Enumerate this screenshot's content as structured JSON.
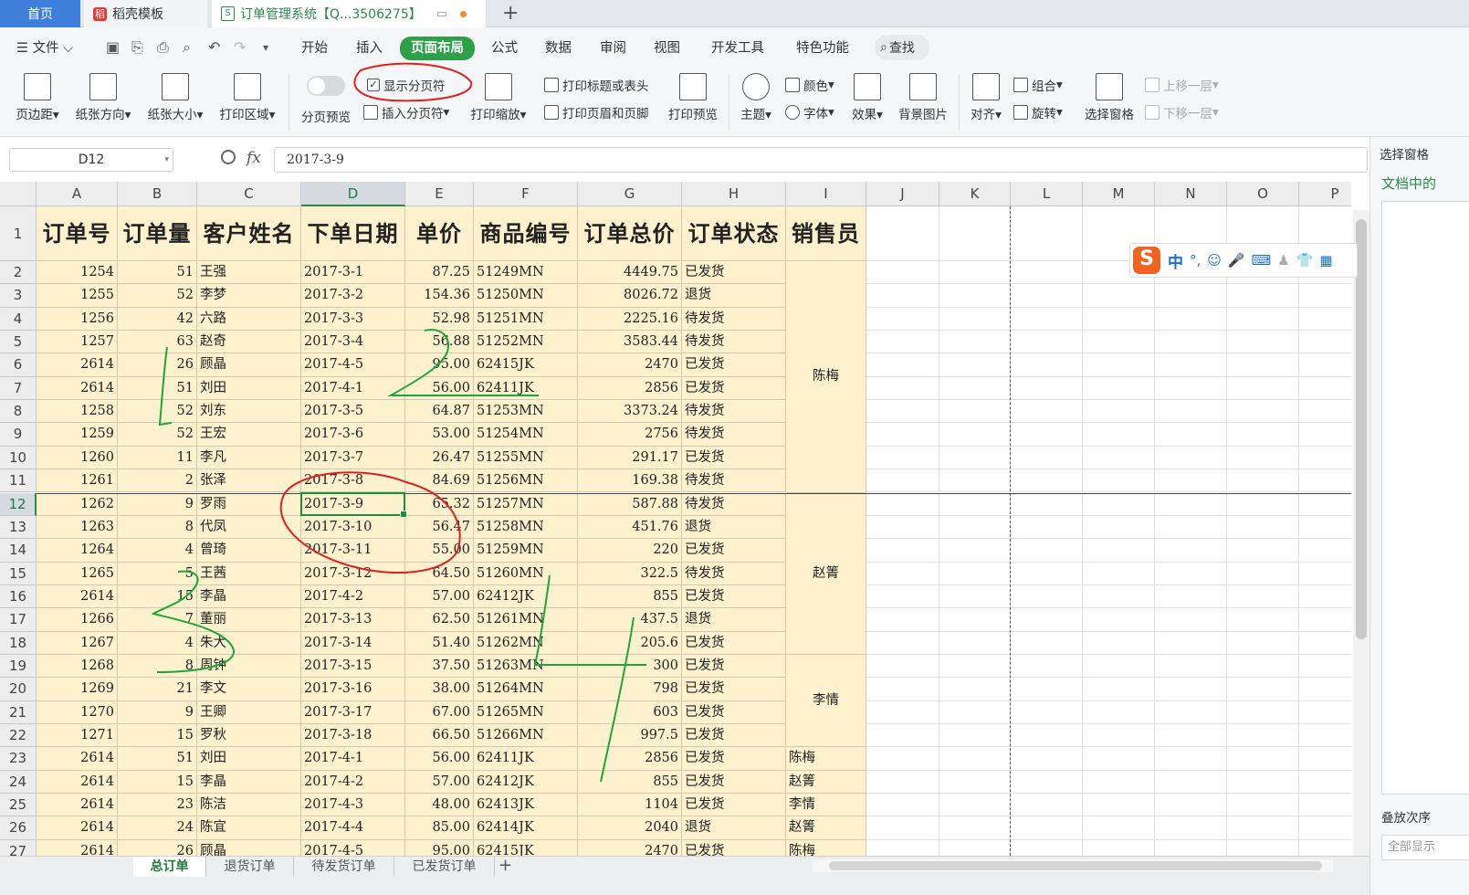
{
  "tabs": {
    "home": "首页",
    "template": "稻壳模板",
    "document": "订单管理系统【Q...3506275】"
  },
  "menu": {
    "file": "文件",
    "items": [
      "开始",
      "插入",
      "页面布局",
      "公式",
      "数据",
      "审阅",
      "视图",
      "开发工具",
      "特色功能"
    ],
    "active": "页面布局",
    "search": "查找"
  },
  "ribbon": {
    "margins": "页边距",
    "orientation": "纸张方向",
    "size": "纸张大小",
    "print_area": "打印区域",
    "page_preview": "分页预览",
    "show_breaks": "显示分页符",
    "insert_break": "插入分页符",
    "print_scale": "打印缩放",
    "print_titles": "打印标题或表头",
    "print_header_footer": "打印页眉和页脚",
    "print_preview": "打印预览",
    "theme": "主题",
    "colors": "颜色",
    "fonts": "字体",
    "effects": "效果",
    "bg_image": "背景图片",
    "align": "对齐",
    "group": "组合",
    "rotate": "旋转",
    "selection_pane": "选择窗格",
    "bring_forward": "上移一层",
    "send_backward": "下移一层"
  },
  "formula": {
    "name_box": "D12",
    "fx": "fx",
    "value": "2017-3-9"
  },
  "columns": [
    "A",
    "B",
    "C",
    "D",
    "E",
    "F",
    "G",
    "H",
    "I",
    "J",
    "K",
    "L",
    "M",
    "N",
    "O",
    "P"
  ],
  "selected_column": "D",
  "selected_row": 12,
  "header_row": [
    "订单号",
    "订单量",
    "客户姓名",
    "下单日期",
    "单价",
    "商品编号",
    "订单总价",
    "订单状态",
    "销售员"
  ],
  "rows": [
    [
      "1254",
      "51",
      "王强",
      "2017-3-1",
      "87.25",
      "51249MN",
      "4449.75",
      "已发货"
    ],
    [
      "1255",
      "52",
      "李梦",
      "2017-3-2",
      "154.36",
      "51250MN",
      "8026.72",
      "退货"
    ],
    [
      "1256",
      "42",
      "六路",
      "2017-3-3",
      "52.98",
      "51251MN",
      "2225.16",
      "待发货"
    ],
    [
      "1257",
      "63",
      "赵奇",
      "2017-3-4",
      "56.88",
      "51252MN",
      "3583.44",
      "待发货"
    ],
    [
      "2614",
      "26",
      "顾晶",
      "2017-4-5",
      "95.00",
      "62415JK",
      "2470",
      "已发货"
    ],
    [
      "2614",
      "51",
      "刘田",
      "2017-4-1",
      "56.00",
      "62411JK",
      "2856",
      "已发货"
    ],
    [
      "1258",
      "52",
      "刘东",
      "2017-3-5",
      "64.87",
      "51253MN",
      "3373.24",
      "待发货"
    ],
    [
      "1259",
      "52",
      "王宏",
      "2017-3-6",
      "53.00",
      "51254MN",
      "2756",
      "待发货"
    ],
    [
      "1260",
      "11",
      "李凡",
      "2017-3-7",
      "26.47",
      "51255MN",
      "291.17",
      "已发货"
    ],
    [
      "1261",
      "2",
      "张泽",
      "2017-3-8",
      "84.69",
      "51256MN",
      "169.38",
      "待发货"
    ],
    [
      "1262",
      "9",
      "罗雨",
      "2017-3-9",
      "65.32",
      "51257MN",
      "587.88",
      "待发货"
    ],
    [
      "1263",
      "8",
      "代凤",
      "2017-3-10",
      "56.47",
      "51258MN",
      "451.76",
      "退货"
    ],
    [
      "1264",
      "4",
      "曾琦",
      "2017-3-11",
      "55.00",
      "51259MN",
      "220",
      "已发货"
    ],
    [
      "1265",
      "5",
      "王茜",
      "2017-3-12",
      "64.50",
      "51260MN",
      "322.5",
      "待发货"
    ],
    [
      "2614",
      "15",
      "李晶",
      "2017-4-2",
      "57.00",
      "62412JK",
      "855",
      "已发货"
    ],
    [
      "1266",
      "7",
      "董丽",
      "2017-3-13",
      "62.50",
      "51261MN",
      "437.5",
      "退货"
    ],
    [
      "1267",
      "4",
      "朱大",
      "2017-3-14",
      "51.40",
      "51262MN",
      "205.6",
      "已发货"
    ],
    [
      "1268",
      "8",
      "周钟",
      "2017-3-15",
      "37.50",
      "51263MN",
      "300",
      "已发货"
    ],
    [
      "1269",
      "21",
      "李文",
      "2017-3-16",
      "38.00",
      "51264MN",
      "798",
      "已发货"
    ],
    [
      "1270",
      "9",
      "王卿",
      "2017-3-17",
      "67.00",
      "51265MN",
      "603",
      "已发货"
    ],
    [
      "1271",
      "15",
      "罗秋",
      "2017-3-18",
      "66.50",
      "51266MN",
      "997.5",
      "已发货"
    ],
    [
      "2614",
      "51",
      "刘田",
      "2017-4-1",
      "56.00",
      "62411JK",
      "2856",
      "已发货"
    ],
    [
      "2614",
      "15",
      "李晶",
      "2017-4-2",
      "57.00",
      "62412JK",
      "855",
      "已发货"
    ],
    [
      "2614",
      "23",
      "陈洁",
      "2017-4-3",
      "48.00",
      "62413JK",
      "1104",
      "已发货"
    ],
    [
      "2614",
      "24",
      "陈宜",
      "2017-4-4",
      "85.00",
      "62414JK",
      "2040",
      "退货"
    ],
    [
      "2614",
      "26",
      "顾晶",
      "2017-4-5",
      "95.00",
      "62415JK",
      "2470",
      "已发货"
    ]
  ],
  "salesperson_merged": [
    {
      "name": "陈梅",
      "from": 2,
      "to": 11
    },
    {
      "name": "赵箐",
      "from": 12,
      "to": 18
    },
    {
      "name": "李情",
      "from": 19,
      "to": 22
    }
  ],
  "salesperson_single": {
    "23": "陈梅",
    "24": "赵箐",
    "25": "李情",
    "26": "赵箐",
    "27": "陈梅"
  },
  "sheets": [
    "总订单",
    "退货订单",
    "待发货订单",
    "已发货订单"
  ],
  "right_panel": {
    "title": "选择窗格",
    "doc": "文档中的",
    "order": "叠放次序",
    "show_all": "全部显示"
  },
  "ime": {
    "mode": "中"
  },
  "colors": {
    "accent": "#2da049",
    "fill": "#fdf1ce",
    "annotation_red": "#e02020",
    "annotation_green": "#1aa83a"
  }
}
